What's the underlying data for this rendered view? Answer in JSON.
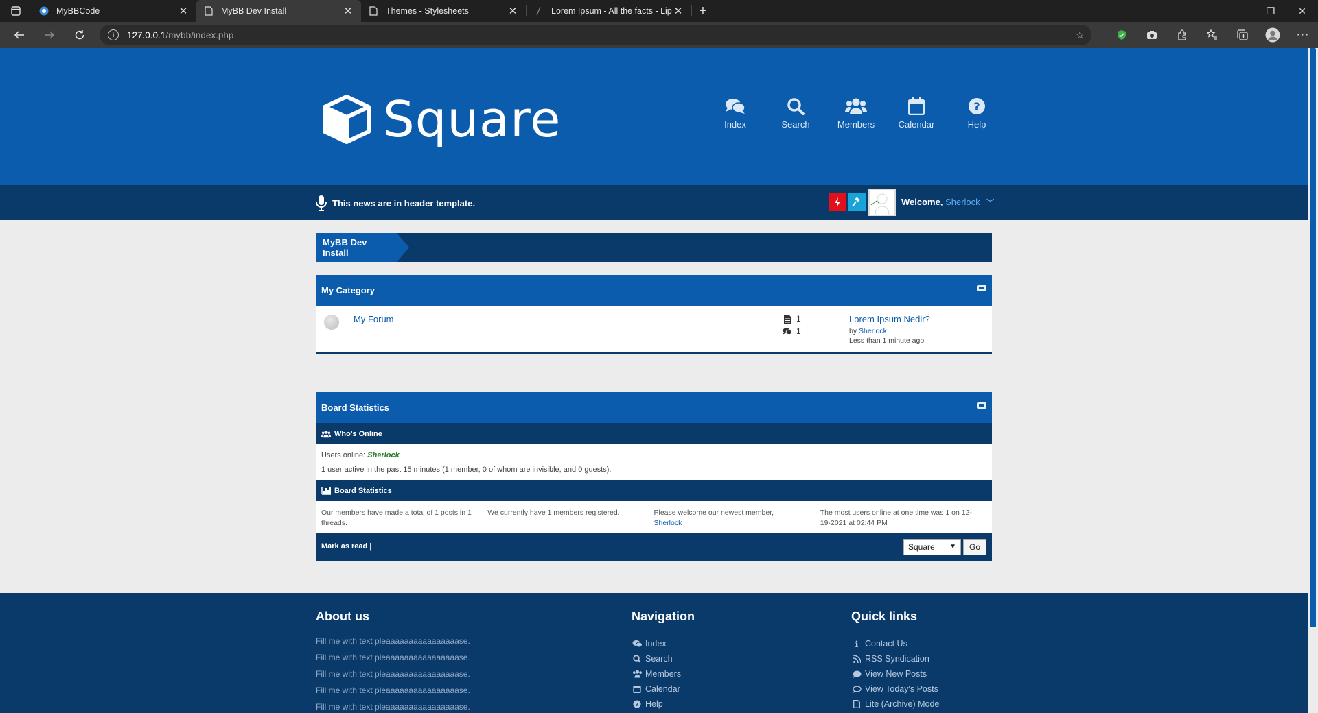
{
  "browser": {
    "tabs": [
      {
        "title": "MyBBCode",
        "icon": "mybb-icon"
      },
      {
        "title": "MyBB Dev Install",
        "icon": "page-icon"
      },
      {
        "title": "Themes - Stylesheets",
        "icon": "page-icon"
      },
      {
        "title": "Lorem Ipsum - All the facts - Lip",
        "icon": "lipsum-icon"
      }
    ],
    "url_host": "127.0.0.1",
    "url_path": "/mybb/index.php"
  },
  "header": {
    "logo_text": "Square",
    "nav": [
      {
        "label": "Index",
        "icon": "comments-icon"
      },
      {
        "label": "Search",
        "icon": "search-icon"
      },
      {
        "label": "Members",
        "icon": "users-icon"
      },
      {
        "label": "Calendar",
        "icon": "calendar-icon"
      },
      {
        "label": "Help",
        "icon": "help-icon"
      }
    ]
  },
  "newsbar": {
    "news_text": "This news are in header template.",
    "welcome_label": "Welcome,",
    "username": "Sherlock",
    "colors": {
      "modcp": "#e3101b",
      "admincp": "#1aa3d9"
    }
  },
  "breadcrumb": {
    "label": "MyBB Dev Install"
  },
  "category": {
    "title": "My Category",
    "forums": [
      {
        "name": "My Forum",
        "threads": "1",
        "posts": "1",
        "lastpost_title": "Lorem Ipsum Nedir?",
        "lastpost_by_label": "by",
        "lastpost_user": "Sherlock",
        "lastpost_time": "Less than 1 minute ago"
      }
    ]
  },
  "stats": {
    "title": "Board Statistics",
    "whos_online_label": "Who's Online",
    "users_online_label": "Users online:",
    "users_online_name": "Sherlock",
    "active_text": "1 user active in the past 15 minutes (1 member, 0 of whom are invisible, and 0 guests).",
    "board_stats_label": "Board Statistics",
    "col1": "Our members have made a total of 1 posts in 1 threads.",
    "col2": "We currently have 1 members registered.",
    "col3": "Please welcome our newest member,",
    "col3_user": "Sherlock",
    "col4": "The most users online at one time was 1 on 12-19-2021 at 02:44 PM",
    "mark_read": "Mark as read |",
    "theme_selected": "Square",
    "go_label": "Go"
  },
  "footer": {
    "about_title": "About us",
    "about_lines": [
      "Fill me with text pleaaaaaaaaaaaaaaaase.",
      "Fill me with text pleaaaaaaaaaaaaaaaase.",
      "Fill me with text pleaaaaaaaaaaaaaaaase.",
      "Fill me with text pleaaaaaaaaaaaaaaaase.",
      "Fill me with text pleaaaaaaaaaaaaaaaase."
    ],
    "nav_title": "Navigation",
    "nav_links": [
      {
        "label": "Index",
        "icon": "comments-icon"
      },
      {
        "label": "Search",
        "icon": "search-icon"
      },
      {
        "label": "Members",
        "icon": "users-icon"
      },
      {
        "label": "Calendar",
        "icon": "calendar-icon"
      },
      {
        "label": "Help",
        "icon": "help-icon"
      }
    ],
    "quick_title": "Quick links",
    "quick_links": [
      {
        "label": "Contact Us",
        "icon": "info-icon"
      },
      {
        "label": "RSS Syndication",
        "icon": "rss-icon"
      },
      {
        "label": "View New Posts",
        "icon": "comment-icon"
      },
      {
        "label": "View Today's Posts",
        "icon": "comment-outline-icon"
      },
      {
        "label": "Lite (Archive) Mode",
        "icon": "file-icon"
      }
    ]
  }
}
